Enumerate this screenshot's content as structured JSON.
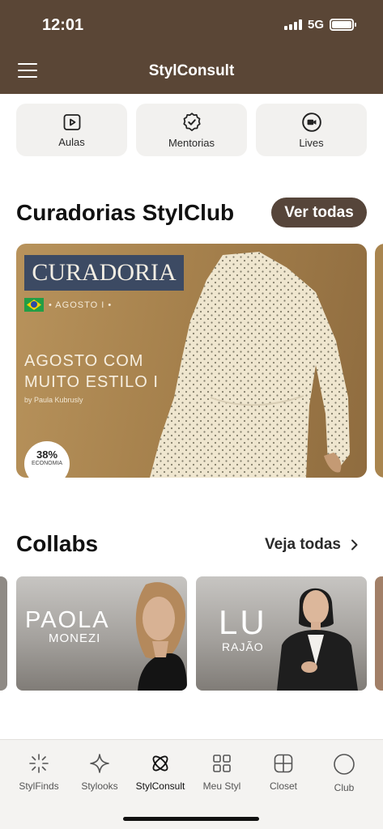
{
  "status_bar": {
    "time": "12:01",
    "network": "5G"
  },
  "header": {
    "title": "StylConsult"
  },
  "quick_tiles": [
    {
      "label": "Aulas",
      "icon": "play-icon"
    },
    {
      "label": "Mentorias",
      "icon": "badge-check-icon"
    },
    {
      "label": "Lives",
      "icon": "video-camera-icon"
    }
  ],
  "curadorias": {
    "title": "Curadorias StylClub",
    "action": "Ver todas",
    "card": {
      "tag": "CURADORIA",
      "month": "• AGOSTO I •",
      "headline_line1": "AGOSTO COM",
      "headline_line2": "MUITO ESTILO I",
      "author": "by Paula Kubrusly",
      "economy_percent": "38%",
      "economy_label": "ECONOMIA"
    }
  },
  "collabs": {
    "title": "Collabs",
    "action": "Veja todas",
    "cards": [
      {
        "first": "PAOLA",
        "last": "MONEZI"
      },
      {
        "first": "LU",
        "last": "RAJÃO"
      }
    ]
  },
  "tabbar": {
    "items": [
      {
        "label": "StylFinds",
        "icon": "sparkle-burst-icon"
      },
      {
        "label": "Stylooks",
        "icon": "star-outline-icon"
      },
      {
        "label": "StylConsult",
        "icon": "interlocked-rings-icon",
        "active": true
      },
      {
        "label": "Meu Styl",
        "icon": "grid-icon"
      },
      {
        "label": "Closet",
        "icon": "closet-icon"
      },
      {
        "label": "Club",
        "icon": "circle-icon"
      }
    ]
  },
  "colors": {
    "brand": "#5a4636",
    "button": "#56453a",
    "tile_bg": "#f2f1ef",
    "curadoria_tag": "#3c4a63"
  }
}
